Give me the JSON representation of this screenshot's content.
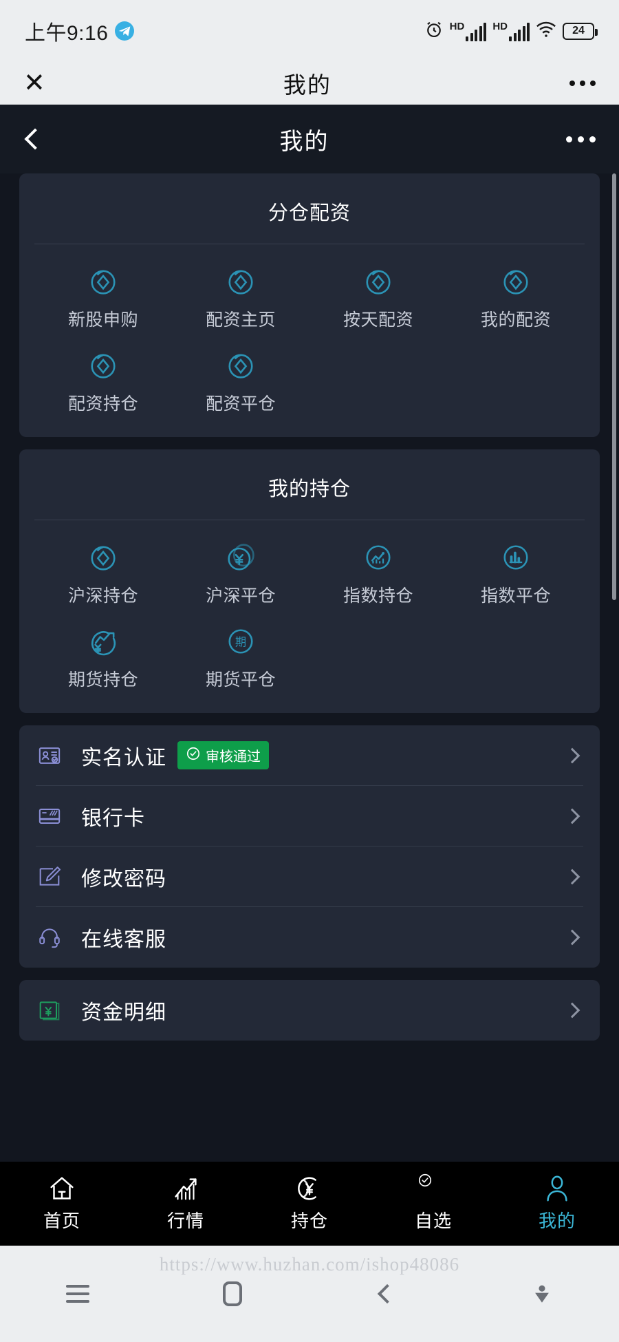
{
  "status_bar": {
    "time": "上午9:16",
    "telegram_icon": "telegram-icon",
    "alarm_icon": "alarm-icon",
    "hd_label_1": "HD",
    "hd_label_2": "HD",
    "wifi_icon": "wifi-icon",
    "battery_level": "24"
  },
  "webview_header": {
    "close_label": "✕",
    "title": "我的",
    "more_label": "more-icon"
  },
  "app_header": {
    "back_label": "back-icon",
    "title": "我的",
    "more_label": "more-icon"
  },
  "cards": [
    {
      "title": "分仓配资",
      "items": [
        {
          "label": "新股申购",
          "icon": "diamond-circle-icon"
        },
        {
          "label": "配资主页",
          "icon": "diamond-circle-icon"
        },
        {
          "label": "按天配资",
          "icon": "diamond-circle-icon"
        },
        {
          "label": "我的配资",
          "icon": "diamond-circle-icon"
        },
        {
          "label": "配资持仓",
          "icon": "diamond-circle-icon"
        },
        {
          "label": "配资平仓",
          "icon": "diamond-circle-icon"
        }
      ]
    },
    {
      "title": "我的持仓",
      "items": [
        {
          "label": "沪深持仓",
          "icon": "diamond-circle-icon"
        },
        {
          "label": "沪深平仓",
          "icon": "yuan-coin-icon"
        },
        {
          "label": "指数持仓",
          "icon": "trend-chart-circle-icon"
        },
        {
          "label": "指数平仓",
          "icon": "bar-chart-circle-icon"
        },
        {
          "label": "期货持仓",
          "icon": "trend-yuan-icon"
        },
        {
          "label": "期货平仓",
          "icon": "futures-qi-icon"
        }
      ]
    }
  ],
  "list_sections": [
    {
      "rows": [
        {
          "label": "实名认证",
          "icon": "id-card-icon",
          "badge": "审核通过",
          "badge_icon": "check-circle-icon"
        },
        {
          "label": "银行卡",
          "icon": "bank-card-icon",
          "badge": ""
        },
        {
          "label": "修改密码",
          "icon": "edit-pencil-icon",
          "badge": ""
        },
        {
          "label": "在线客服",
          "icon": "headset-icon",
          "badge": ""
        }
      ]
    },
    {
      "rows": [
        {
          "label": "资金明细",
          "icon": "yuan-book-icon",
          "badge": ""
        }
      ]
    }
  ],
  "tabbar": [
    {
      "label": "首页",
      "icon": "home-icon",
      "active": false
    },
    {
      "label": "行情",
      "icon": "market-chart-icon",
      "active": false
    },
    {
      "label": "持仓",
      "icon": "yuan-position-icon",
      "active": false
    },
    {
      "label": "自选",
      "icon": "check-circle-icon",
      "active": false
    },
    {
      "label": "我的",
      "icon": "person-icon",
      "active": true
    }
  ],
  "android_nav": {
    "menu_icon": "hamburger-icon",
    "home_icon": "home-square-icon",
    "back_icon": "back-icon",
    "download_icon": "download-icon"
  },
  "watermark": "https://www.huzhan.com/ishop48086",
  "colors": {
    "accent_teal": "#2b93b5",
    "badge_green": "#0e9e4a",
    "card_bg": "#232937",
    "page_bg": "#12161f",
    "tab_active": "#3bb6d6"
  }
}
